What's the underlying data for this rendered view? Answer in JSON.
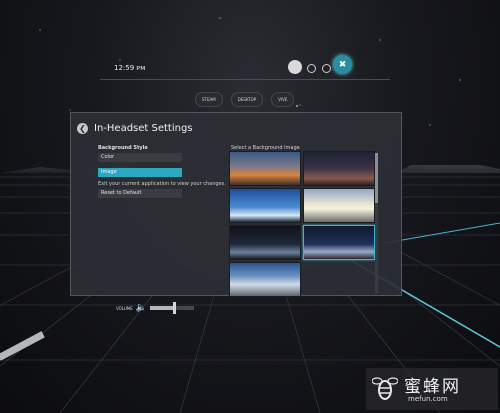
{
  "clock": "12:59 ᴘᴍ",
  "top_buttons": {
    "close_icon": "close-icon"
  },
  "nav_pills": [
    "STEAM",
    "DESKTOP",
    "VIVE"
  ],
  "panel": {
    "title": "In-Headset Settings",
    "background_style_label": "Background Style",
    "options": [
      {
        "label": "Color",
        "selected": false
      },
      {
        "label": "Image",
        "selected": true
      }
    ],
    "exit_text": "Exit your current application to view your changes.",
    "reset_button": "Reset to Default",
    "select_label": "Select a Background Image",
    "images": [
      {
        "name": "sunset-mountain",
        "selected": false
      },
      {
        "name": "night-sky-glow",
        "selected": false
      },
      {
        "name": "blue-cloud-sky",
        "selected": false
      },
      {
        "name": "bright-clouds",
        "selected": false
      },
      {
        "name": "dark-horizon",
        "selected": false
      },
      {
        "name": "night-city-glow",
        "selected": true
      },
      {
        "name": "overcast-sky",
        "selected": false
      }
    ]
  },
  "volume": {
    "label": "VOLUME",
    "level": 0.55
  },
  "watermark": {
    "cn": "蜜蜂网",
    "en": "mefun.com"
  },
  "colors": {
    "accent": "#2aa7c1",
    "panel": "#2d2f35"
  }
}
